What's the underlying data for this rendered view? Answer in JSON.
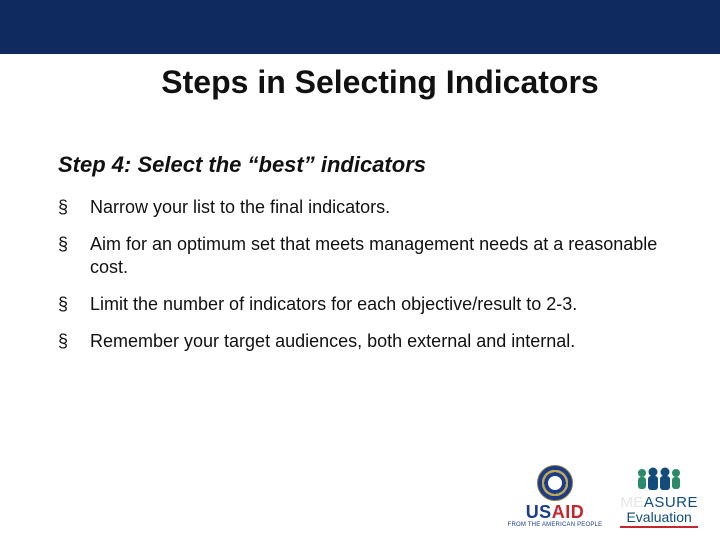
{
  "title": "Steps in Selecting Indicators",
  "subtitle": "Step 4:  Select the “best” indicators",
  "bullets": [
    "Narrow your list to the final indicators.",
    "Aim for an optimum set that meets management needs at a reasonable cost.",
    "Limit the number of indicators for each objective/result to 2-3.",
    "Remember your target audiences, both external and internal."
  ],
  "logos": {
    "usaid": {
      "word_left": "US",
      "word_right": "AID",
      "tagline": "FROM THE AMERICAN PEOPLE"
    },
    "measure": {
      "word_fade": "ME",
      "word_main": "ASURE",
      "sub": "Evaluation"
    }
  }
}
